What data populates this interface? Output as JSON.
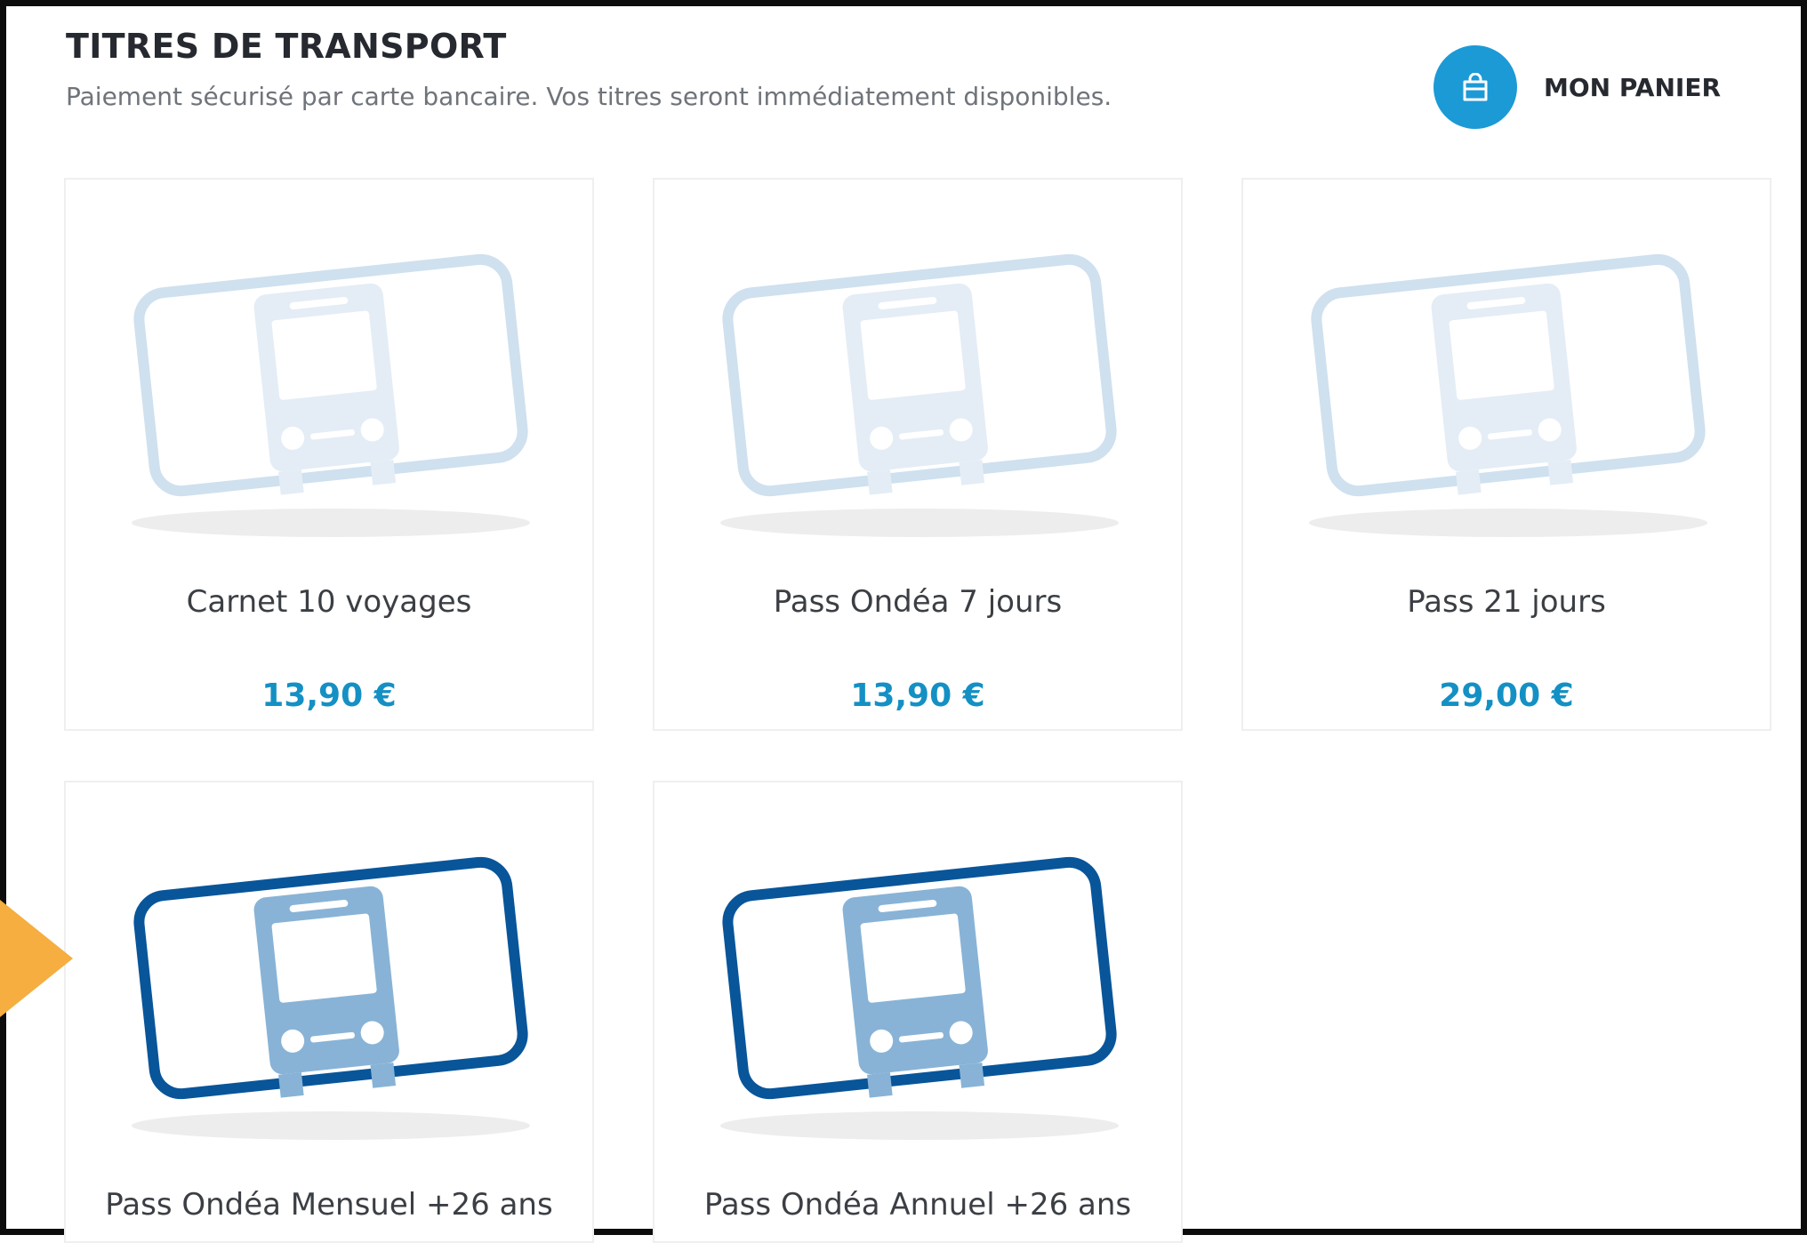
{
  "header": {
    "title": "TITRES DE TRANSPORT",
    "subtitle": "Paiement sécurisé par carte bancaire. Vos titres seront immédiatement disponibles."
  },
  "cart": {
    "label": "MON PANIER",
    "icon": "shopping-bag-icon"
  },
  "products": [
    {
      "name": "Carnet 10 voyages",
      "price": "13,90 €",
      "icon": "bus-ticket-icon",
      "style": "light"
    },
    {
      "name": "Pass Ondéa 7 jours",
      "price": "13,90 €",
      "icon": "bus-ticket-icon",
      "style": "light"
    },
    {
      "name": "Pass 21 jours",
      "price": "29,00 €",
      "icon": "bus-ticket-icon",
      "style": "light"
    },
    {
      "name": "Pass Ondéa Mensuel +26 ans",
      "icon": "bus-ticket-icon",
      "style": "dark"
    },
    {
      "name": "Pass Ondéa Annuel +26 ans",
      "icon": "bus-ticket-icon",
      "style": "dark"
    }
  ],
  "colors": {
    "accent": "#1c9ad6",
    "price": "#1490c4",
    "ticket_light_border": "#cfe0ef",
    "ticket_light_bus": "#e4edf5",
    "ticket_dark_border": "#08559a",
    "ticket_dark_bus": "#88b3d6",
    "pointer_arrow": "#f5ae3f"
  }
}
